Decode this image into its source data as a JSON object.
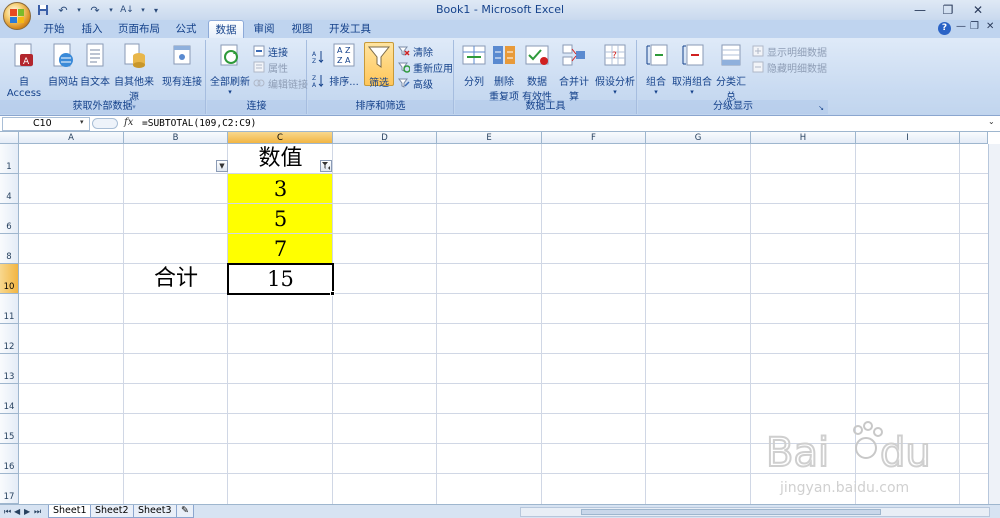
{
  "window": {
    "title": "Book1 - Microsoft Excel",
    "controls": [
      "minimize",
      "restore",
      "close"
    ]
  },
  "tabs": [
    "开始",
    "插入",
    "页面布局",
    "公式",
    "数据",
    "审阅",
    "视图",
    "开发工具"
  ],
  "active_tab": "数据",
  "ribbon": {
    "groups": {
      "external": {
        "label": "获取外部数据",
        "buttons": [
          "自 Access",
          "自网站",
          "自文本",
          "自其他来源",
          "现有连接"
        ]
      },
      "connections": {
        "label": "连接",
        "refresh": "全部刷新",
        "items": [
          "连接",
          "属性",
          "编辑链接"
        ]
      },
      "sort_filter": {
        "label": "排序和筛选",
        "sort": "排序...",
        "filter": "筛选",
        "items": [
          "清除",
          "重新应用",
          "高级"
        ]
      },
      "data_tools": {
        "label": "数据工具",
        "buttons": [
          "分列",
          "删除",
          "重复项",
          "数据",
          "有效性",
          "合并计算",
          "假设分析"
        ]
      },
      "outline": {
        "label": "分级显示",
        "buttons": [
          "组合",
          "取消组合",
          "分类汇总"
        ],
        "items": [
          "显示明细数据",
          "隐藏明细数据"
        ]
      }
    }
  },
  "formula_bar": {
    "name_box": "C10",
    "fx": "fx",
    "formula": "=SUBTOTAL(109,C2:C9)"
  },
  "columns": [
    "A",
    "B",
    "C",
    "D",
    "E",
    "F",
    "G",
    "H",
    "I"
  ],
  "rows": [
    "1",
    "4",
    "6",
    "8",
    "10",
    "11",
    "12",
    "13",
    "14",
    "15",
    "16",
    "17"
  ],
  "cells": {
    "header": "数值",
    "values": [
      "3",
      "5",
      "7"
    ],
    "total_label": "合计",
    "total_value": "15"
  },
  "sheets": [
    "Sheet1",
    "Sheet2",
    "Sheet3"
  ],
  "colors": {
    "highlight": "#ffff00",
    "accent": "#15428b"
  }
}
